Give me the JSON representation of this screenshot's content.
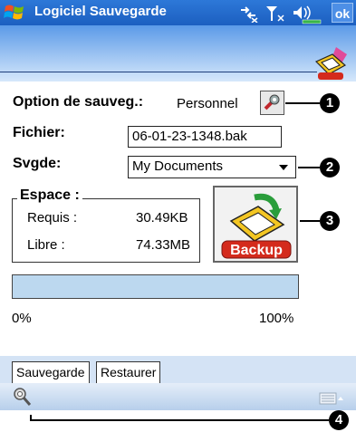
{
  "titlebar": {
    "title": "Logiciel Sauvegarde",
    "ok_label": "ok",
    "start_icon": "windows-flag-icon",
    "status_icons": [
      "connectivity-icon",
      "signal-icon",
      "volume-icon",
      "battery-icon"
    ]
  },
  "form": {
    "option_label": "Option de sauveg.:",
    "option_value": "Personnel",
    "file_label": "Fichier:",
    "file_value": "06-01-23-1348.bak",
    "backup_to_label": "Svgde:",
    "backup_to_value": "My Documents"
  },
  "space": {
    "title": "Espace :",
    "required_label": "Requis :",
    "required_value": "30.49KB",
    "free_label": "Libre :",
    "free_value": "74.33MB"
  },
  "backup_button": {
    "label": "Backup"
  },
  "progress": {
    "value": 0,
    "min_label": "0%",
    "max_label": "100%"
  },
  "tabs": [
    {
      "label": "Sauvegarde",
      "active": true
    },
    {
      "label": "Restaurer",
      "active": false
    }
  ],
  "callouts": [
    "1",
    "2",
    "3",
    "4"
  ],
  "colors": {
    "titlebar": "#1c5fc0",
    "header_gradient_top": "#5b9ae8",
    "progress_fill": "#bcd8ef",
    "backup_red": "#d42a1c"
  }
}
